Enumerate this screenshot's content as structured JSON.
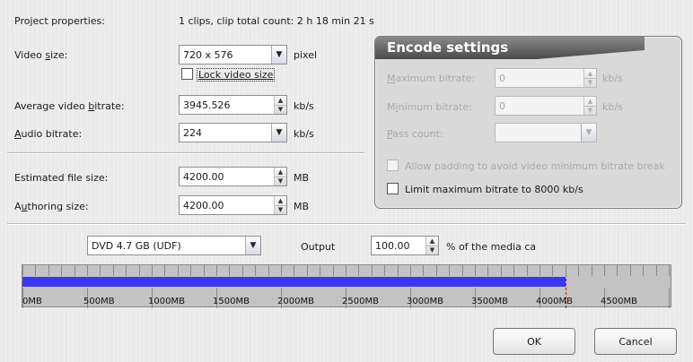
{
  "project": {
    "label": "Project properties:",
    "value": "1 clips,  clip total count: 2 h 18 min 21 s"
  },
  "video_size": {
    "label": "Video size:",
    "value": "720 x 576",
    "unit": "pixel"
  },
  "lock_video_size": {
    "label": "Lock video size",
    "checked": false
  },
  "avg_bitrate": {
    "label": "Average video bitrate:",
    "value": "3945.526",
    "unit": "kb/s"
  },
  "audio_bitrate": {
    "label": "Audio bitrate:",
    "value": "224",
    "unit": "kb/s"
  },
  "est_file_size": {
    "label": "Estimated file size:",
    "value": "4200.00",
    "unit": "MB"
  },
  "authoring_size": {
    "label": "Authoring size:",
    "value": "4200.00",
    "unit": "MB"
  },
  "encode": {
    "title": "Encode settings",
    "max_bitrate": {
      "label": "Maximum bitrate:",
      "value": "0",
      "unit": "kb/s"
    },
    "min_bitrate": {
      "label": "Minimum bitrate:",
      "value": "0",
      "unit": "kb/s"
    },
    "pass_count": {
      "label": "Pass count:",
      "value": ""
    },
    "allow_padding": {
      "label": "Allow padding to avoid video minimum bitrate break",
      "checked": false
    },
    "limit_max": {
      "label": "Limit maximum bitrate to 8000 kb/s",
      "checked": false
    }
  },
  "media": {
    "value": "DVD 4.7 GB (UDF)"
  },
  "output": {
    "label": "Output",
    "value": "100.00",
    "suffix": "% of the media ca"
  },
  "usage_bar": {
    "fill_mb": 4200,
    "capacity_mb": 4700,
    "tick_labels": [
      "0MB",
      "500MB",
      "1000MB",
      "1500MB",
      "2000MB",
      "2500MB",
      "3000MB",
      "3500MB",
      "4000MB",
      "4500MB"
    ],
    "fill_color": "#3838f4",
    "marker_color": "#c01010"
  },
  "buttons": {
    "ok": "OK",
    "cancel": "Cancel"
  }
}
